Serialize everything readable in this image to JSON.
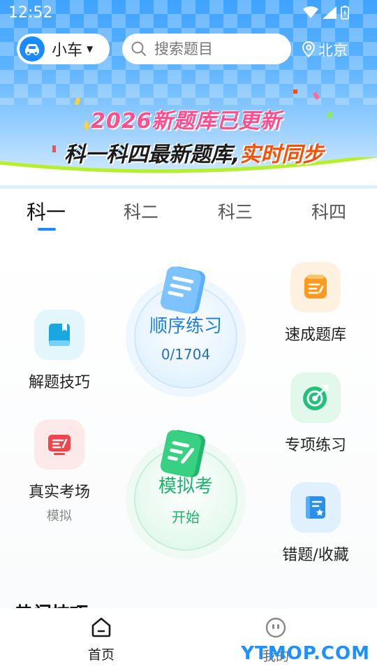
{
  "status_bar": {
    "time": "12:52"
  },
  "header": {
    "car_type": "小车",
    "search_placeholder": "搜索题目",
    "location": "北京"
  },
  "banner": {
    "line1": "2026新题库已更新",
    "line2_prefix": "科一科四最新题库,",
    "line2_highlight": "实时同步"
  },
  "tabs": [
    {
      "label": "科一",
      "active": true
    },
    {
      "label": "科二",
      "active": false
    },
    {
      "label": "科三",
      "active": false
    },
    {
      "label": "科四",
      "active": false
    }
  ],
  "features": {
    "tips": {
      "label": "解题技巧",
      "icon": "book-icon"
    },
    "real_exam": {
      "label": "真实考场",
      "sub": "模拟",
      "icon": "screen-icon"
    },
    "quick_bank": {
      "label": "速成题库",
      "icon": "list-icon"
    },
    "special": {
      "label": "专项练习",
      "icon": "target-icon"
    },
    "mistakes": {
      "label": "错题/收藏",
      "icon": "bookmark-icon"
    }
  },
  "sequential": {
    "title": "顺序练习",
    "progress": "0/1704",
    "done": 0,
    "total": 1704
  },
  "mock_exam": {
    "title": "模拟考",
    "action": "开始"
  },
  "section": {
    "title": "热门技巧"
  },
  "nav": [
    {
      "label": "首页",
      "icon": "home-icon",
      "active": true
    },
    {
      "label": "我的",
      "icon": "profile-icon",
      "active": false
    }
  ],
  "watermark": "YTMOP.COM",
  "colors": {
    "primary": "#1b8cff",
    "accent_green": "#22c17a",
    "banner_pink": "#ff4d8d",
    "banner_orange": "#ff4d00"
  }
}
